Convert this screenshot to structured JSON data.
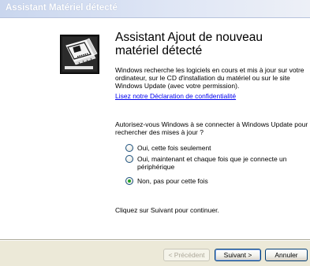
{
  "window": {
    "title": "Assistant Matériel détecté"
  },
  "wizard": {
    "heading": "Assistant Ajout de nouveau matériel détecté",
    "intro": "Windows recherche les logiciels en cours et mis à jour sur votre ordinateur, sur le CD d'installation du matériel ou sur le site Windows Update (avec votre permission).",
    "privacy_link": "Lisez notre Déclaration de confidentialité",
    "question": "Autorisez-vous Windows à se connecter à Windows Update pour rechercher des mises à jour ?",
    "options": [
      {
        "label": "Oui, cette fois seulement",
        "selected": false
      },
      {
        "label": "Oui, maintenant et chaque fois que je connecte un périphérique",
        "selected": false
      },
      {
        "label": "Non, pas pour cette fois",
        "selected": true
      }
    ],
    "continue_text": "Cliquez sur Suivant pour continuer."
  },
  "buttons": {
    "back": "< Précédent",
    "next": "Suivant >",
    "cancel": "Annuler"
  },
  "icons": {
    "wizard": "hardware-card-icon"
  }
}
